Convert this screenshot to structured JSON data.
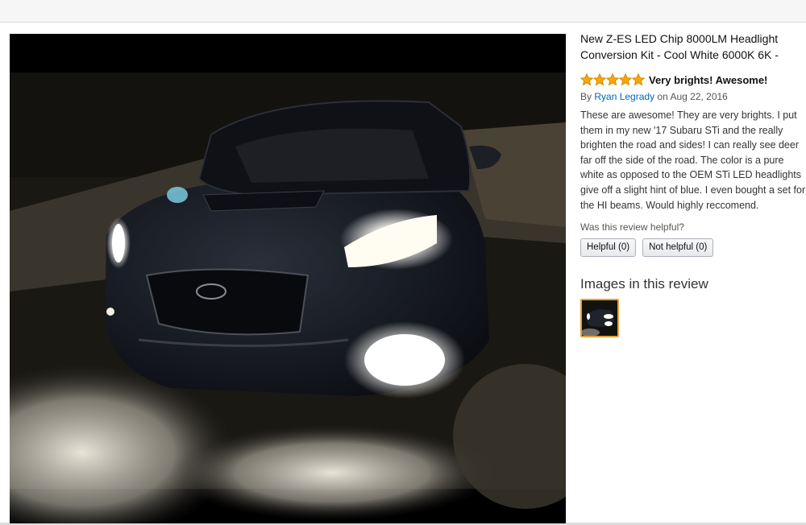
{
  "product": {
    "title": "New Z-ES LED Chip 8000LM Headlight Conversion Kit - Cool White 6000K 6K -"
  },
  "review": {
    "rating": 5,
    "rating_max": 5,
    "headline": "Very brights! Awesome!",
    "by_prefix": "By",
    "author": "Ryan Legrady",
    "date_text": "on Aug 22, 2016",
    "body": "These are awesome! They are very brights. I put them in my new '17 Subaru STi and the really brighten the road and sides! I can really see deer far off the side of the road. The color is a pure white as opposed to the OEM STi LED headlights give off a slight hint of blue. I even bought a set for the HI beams. Would highly reccomend.",
    "helpful_question": "Was this review helpful?",
    "helpful_button": "Helpful (0)",
    "not_helpful_button": "Not helpful (0)"
  },
  "images_section": {
    "heading": "Images in this review",
    "count": 1
  },
  "colors": {
    "star": "#f7a800",
    "link": "#0066c0",
    "thumb_border": "#e3a13c"
  },
  "icons": {
    "star": "star-icon",
    "photo": "car-headlights-photo"
  }
}
